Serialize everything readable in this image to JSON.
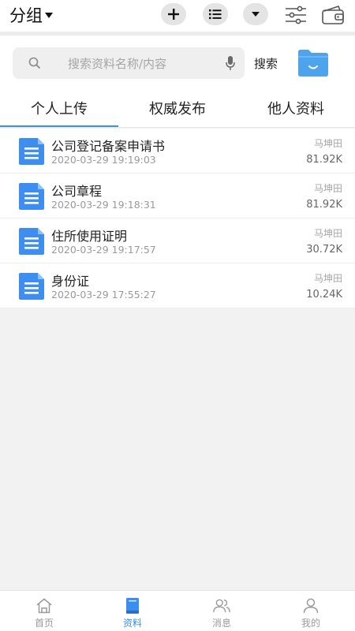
{
  "header": {
    "group_label": "分组"
  },
  "search": {
    "placeholder": "搜索资料名称/内容",
    "button_label": "搜索"
  },
  "tabs": [
    {
      "label": "个人上传",
      "active": true
    },
    {
      "label": "权威发布",
      "active": false
    },
    {
      "label": "他人资料",
      "active": false
    }
  ],
  "files": [
    {
      "name": "公司登记备案申请书",
      "date": "2020-03-29 19:19:03",
      "owner": "马坤田",
      "size": "81.92K"
    },
    {
      "name": "公司章程",
      "date": "2020-03-29 19:18:31",
      "owner": "马坤田",
      "size": "81.92K"
    },
    {
      "name": "住所使用证明",
      "date": "2020-03-29 19:17:57",
      "owner": "马坤田",
      "size": "30.72K"
    },
    {
      "name": "身份证",
      "date": "2020-03-29 17:55:27",
      "owner": "马坤田",
      "size": "10.24K"
    }
  ],
  "bottom_nav": [
    {
      "label": "首页",
      "icon": "home-icon",
      "active": false
    },
    {
      "label": "资料",
      "icon": "book-icon",
      "active": true
    },
    {
      "label": "消息",
      "icon": "contacts-icon",
      "active": false
    },
    {
      "label": "我的",
      "icon": "user-icon",
      "active": false
    }
  ],
  "colors": {
    "accent": "#3a8ef0",
    "doc_icon": "#3d8ef0",
    "folder_icon": "#4da3ec"
  },
  "icons": {
    "toolbar": [
      "plus-icon",
      "list-icon",
      "caret-down-icon",
      "sliders-icon",
      "wallet-icon"
    ],
    "search": [
      "search-icon",
      "microphone-icon",
      "folder-icon"
    ],
    "file": "document-icon"
  }
}
